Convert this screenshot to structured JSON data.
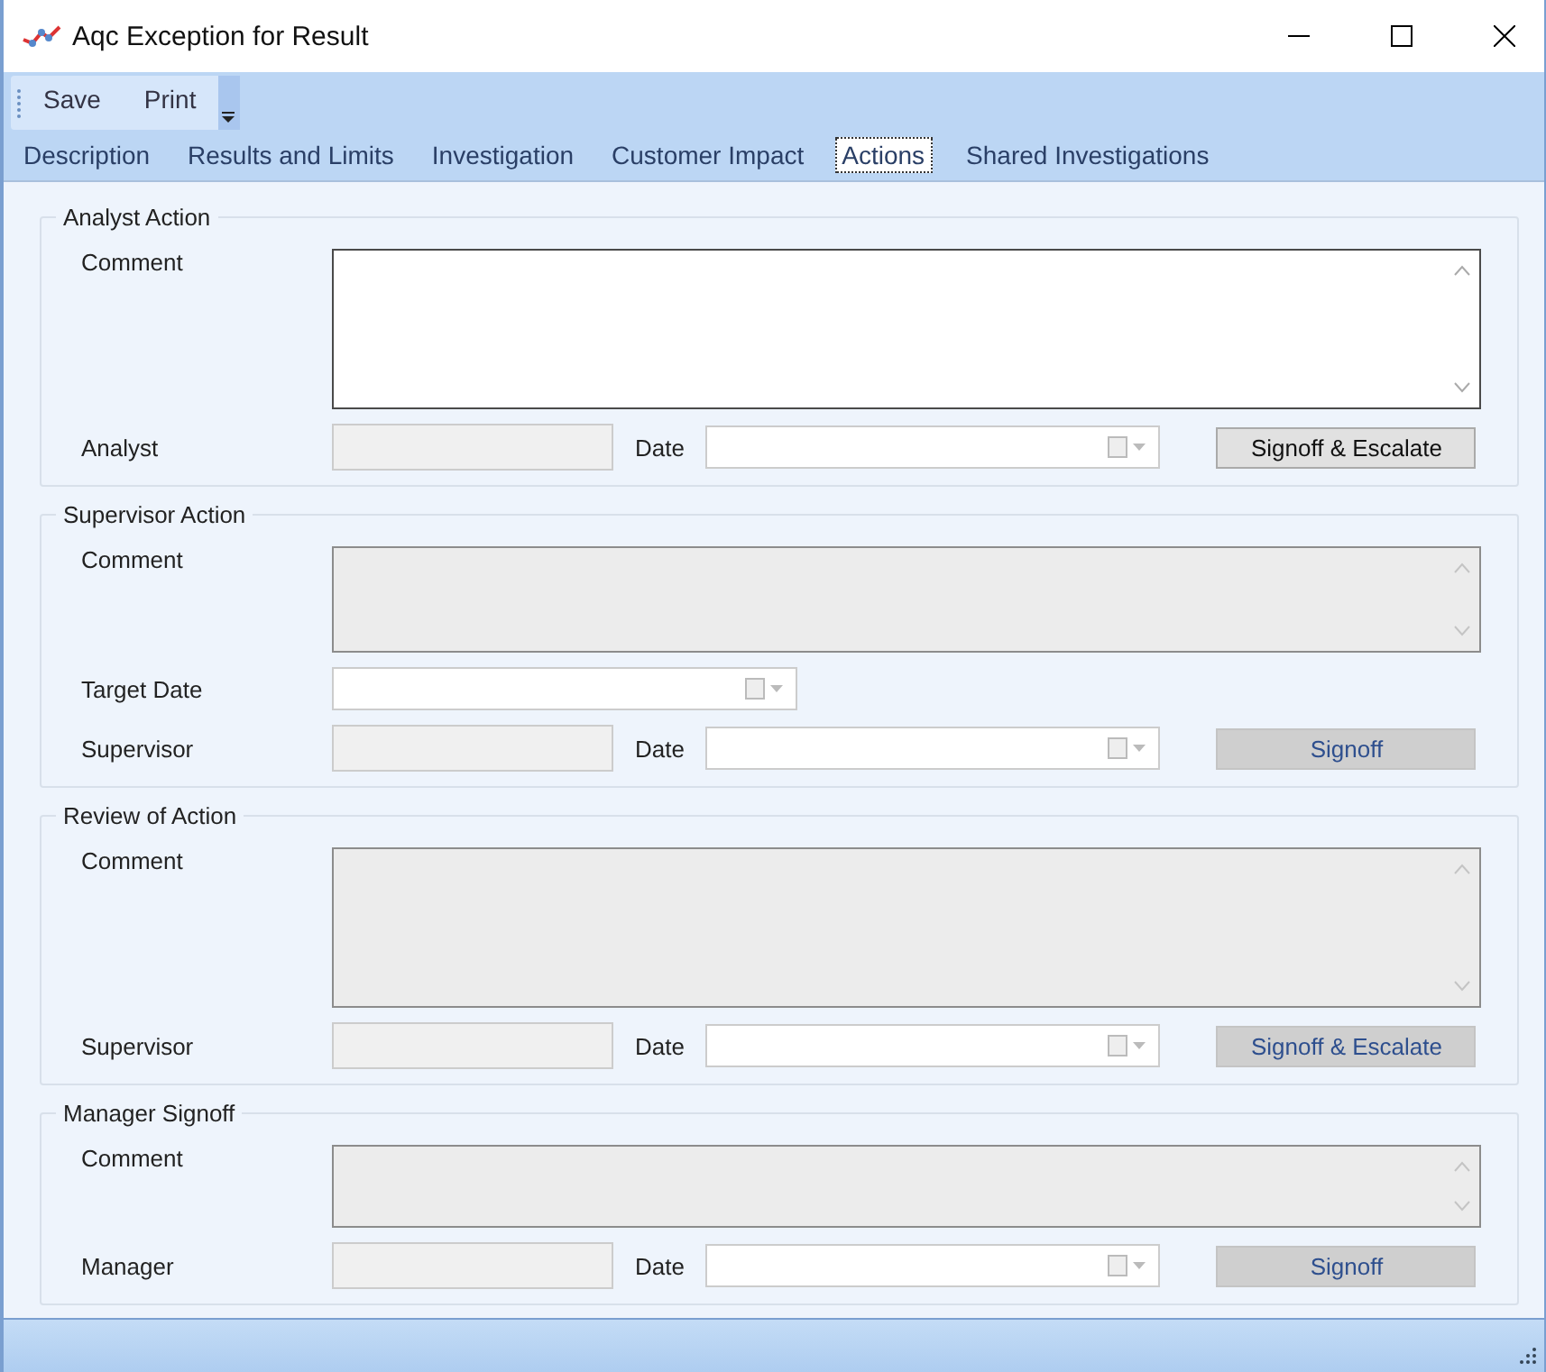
{
  "window": {
    "title": "Aqc Exception for Result"
  },
  "toolbar": [
    "Save",
    "Print"
  ],
  "tabs": [
    {
      "label": "Description",
      "selected": false
    },
    {
      "label": "Results and Limits",
      "selected": false
    },
    {
      "label": "Investigation",
      "selected": false
    },
    {
      "label": "Customer Impact",
      "selected": false
    },
    {
      "label": "Actions",
      "selected": true
    },
    {
      "label": "Shared Investigations",
      "selected": false
    }
  ],
  "sections": [
    {
      "title": "Analyst Action",
      "comment_label": "Comment",
      "comment_disabled": false,
      "person_label": "Analyst",
      "person_disabled": true,
      "date_label": "Date",
      "button": {
        "label": "Signoff & Escalate",
        "disabled": false
      }
    },
    {
      "title": "Supervisor Action",
      "comment_label": "Comment",
      "comment_disabled": true,
      "target_date_label": "Target Date",
      "person_label": "Supervisor",
      "person_disabled": true,
      "date_label": "Date",
      "button": {
        "label": "Signoff",
        "disabled": true
      }
    },
    {
      "title": "Review of Action",
      "comment_label": "Comment",
      "comment_disabled": true,
      "person_label": "Supervisor",
      "person_disabled": true,
      "date_label": "Date",
      "button": {
        "label": "Signoff & Escalate",
        "disabled": true
      }
    },
    {
      "title": "Manager Signoff",
      "comment_label": "Comment",
      "comment_disabled": true,
      "person_label": "Manager",
      "person_disabled": true,
      "date_label": "Date",
      "button": {
        "label": "Signoff",
        "disabled": true
      }
    }
  ]
}
